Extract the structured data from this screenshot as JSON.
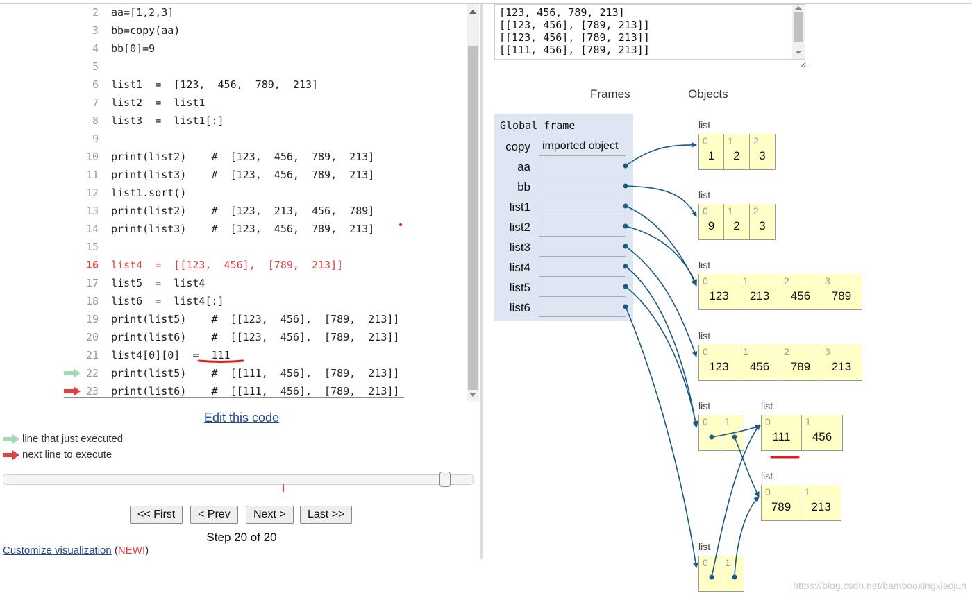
{
  "code": {
    "lines": [
      {
        "num": "2",
        "text": "aa=[1,2,3]"
      },
      {
        "num": "3",
        "text": "bb=copy(aa)"
      },
      {
        "num": "4",
        "text": "bb[0]=9"
      },
      {
        "num": "5",
        "text": ""
      },
      {
        "num": "6",
        "text": "list1  =  [123,  456,  789,  213]"
      },
      {
        "num": "7",
        "text": "list2  =  list1"
      },
      {
        "num": "8",
        "text": "list3  =  list1[:]"
      },
      {
        "num": "9",
        "text": ""
      },
      {
        "num": "10",
        "text": "print(list2)    #  [123,  456,  789,  213]"
      },
      {
        "num": "11",
        "text": "print(list3)    #  [123,  456,  789,  213]"
      },
      {
        "num": "12",
        "text": "list1.sort()"
      },
      {
        "num": "13",
        "text": "print(list2)    #  [123,  213,  456,  789]"
      },
      {
        "num": "14",
        "text": "print(list3)    #  [123,  456,  789,  213]"
      },
      {
        "num": "15",
        "text": ""
      },
      {
        "num": "16",
        "text": "list4  =  [[123,  456],  [789,  213]]",
        "current": true
      },
      {
        "num": "17",
        "text": "list5  =  list4"
      },
      {
        "num": "18",
        "text": "list6  =  list4[:]"
      },
      {
        "num": "19",
        "text": "print(list5)    #  [[123,  456],  [789,  213]]"
      },
      {
        "num": "20",
        "text": "print(list6)    #  [[123,  456],  [789,  213]]"
      },
      {
        "num": "21",
        "text": "list4[0][0]  =  111"
      },
      {
        "num": "22",
        "text": "print(list5)    #  [[111,  456],  [789,  213]]",
        "arrow": "green"
      },
      {
        "num": "23",
        "text": "print(list6)    #  [[111,  456],  [789,  213]]",
        "arrow": "red"
      }
    ]
  },
  "edit_link": "Edit this code",
  "legend": {
    "just_executed": "line that just executed",
    "next_line": "next line to execute"
  },
  "slider": {
    "value": 20,
    "max": 20
  },
  "nav": {
    "first": "<< First",
    "prev": "< Prev",
    "next": "Next >",
    "last": "Last >>"
  },
  "step_label": "Step 20 of 20",
  "customize": {
    "link": "Customize visualization",
    "new_badge": "NEW!"
  },
  "output": {
    "lines": [
      "[123, 456, 789, 213]",
      "[[123, 456], [789, 213]]",
      "[[123, 456], [789, 213]]",
      "[[111, 456], [789, 213]]"
    ]
  },
  "headers": {
    "frames": "Frames",
    "objects": "Objects"
  },
  "global_frame": {
    "title": "Global frame",
    "vars": [
      {
        "name": "copy",
        "value": "imported object"
      },
      {
        "name": "aa",
        "value": ""
      },
      {
        "name": "bb",
        "value": ""
      },
      {
        "name": "list1",
        "value": ""
      },
      {
        "name": "list2",
        "value": ""
      },
      {
        "name": "list3",
        "value": ""
      },
      {
        "name": "list4",
        "value": ""
      },
      {
        "name": "list5",
        "value": ""
      },
      {
        "name": "list6",
        "value": ""
      }
    ]
  },
  "heap": [
    {
      "id": "aa_list",
      "label": "list",
      "items": [
        "1",
        "2",
        "3"
      ]
    },
    {
      "id": "bb_list",
      "label": "list",
      "items": [
        "9",
        "2",
        "3"
      ]
    },
    {
      "id": "list1_obj",
      "label": "list",
      "items": [
        "123",
        "213",
        "456",
        "789"
      ]
    },
    {
      "id": "list3_obj",
      "label": "list",
      "items": [
        "123",
        "456",
        "789",
        "213"
      ]
    },
    {
      "id": "list4_obj",
      "label": "list",
      "items": [
        "",
        ""
      ]
    },
    {
      "id": "inner_a",
      "label": "list",
      "items": [
        "111",
        "456"
      ]
    },
    {
      "id": "inner_b",
      "label": "list",
      "items": [
        "789",
        "213"
      ]
    },
    {
      "id": "list6_obj",
      "label": "list",
      "items": [
        "",
        ""
      ]
    }
  ],
  "watermark": "https://blog.csdn.net/bambooxingxiaojun",
  "colors": {
    "accent_red": "#e04040",
    "arrow_green": "#a8d8b0",
    "link": "#1e4b8e",
    "pointer": "#1a5a80",
    "cell_bg": "#ffffc6",
    "frame_bg": "#dde6f2"
  }
}
